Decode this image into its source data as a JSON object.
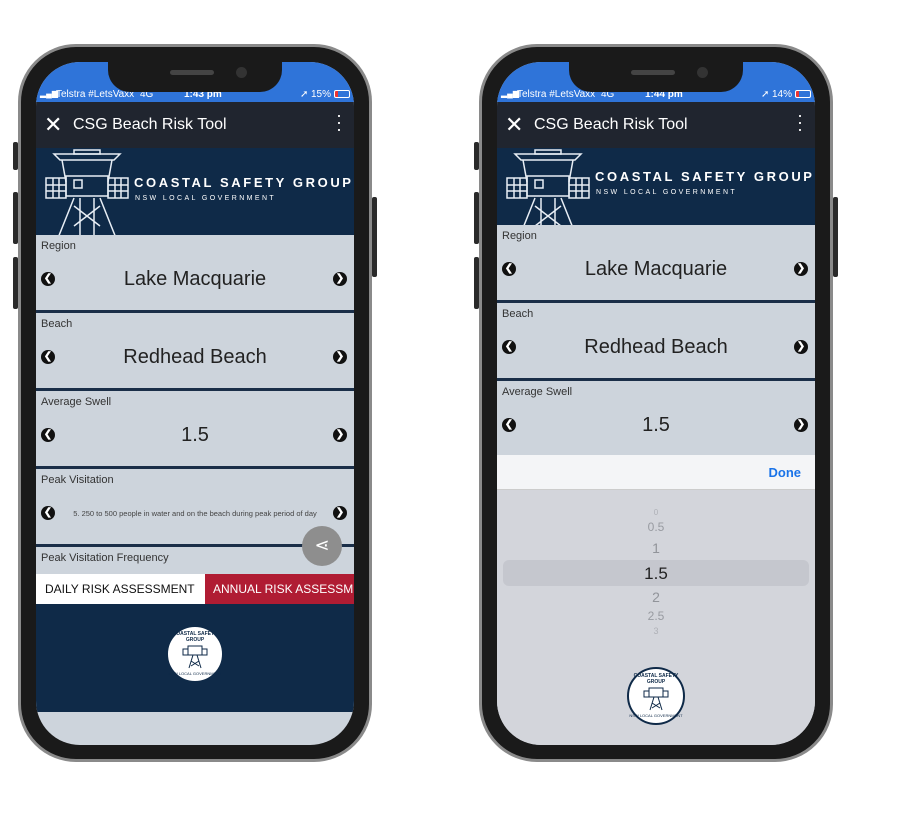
{
  "phones": [
    {
      "status": {
        "carrier": "Telstra #LetsVaxx",
        "network": "4G",
        "time": "1:43 pm",
        "battery": "15%"
      },
      "app_title": "CSG Beach Risk Tool",
      "banner": {
        "title": "COASTAL SAFETY GROUP",
        "subtitle": "NSW LOCAL GOVERNMENT"
      },
      "fields": [
        {
          "label": "Region",
          "value": "Lake Macquarie"
        },
        {
          "label": "Beach",
          "value": "Redhead Beach"
        },
        {
          "label": "Average Swell",
          "value": "1.5"
        },
        {
          "label": "Peak Visitation",
          "value": "5. 250 to 500 people in water and on the beach during peak period of day"
        },
        {
          "label": "Peak Visitation Frequency"
        }
      ],
      "tabs": [
        {
          "label": "DAILY RISK ASSESSMENT",
          "active": true
        },
        {
          "label": "ANNUAL RISK ASSESSM",
          "active": false
        }
      ],
      "seal": {
        "top": "COASTAL SAFETY GROUP",
        "bottom": "NSW LOCAL GOVERNMENT"
      }
    },
    {
      "status": {
        "carrier": "Telstra #LetsVaxx",
        "network": "4G",
        "time": "1:44 pm",
        "battery": "14%"
      },
      "app_title": "CSG Beach Risk Tool",
      "banner": {
        "title": "COASTAL SAFETY GROUP",
        "subtitle": "NSW LOCAL GOVERNMENT"
      },
      "fields": [
        {
          "label": "Region",
          "value": "Lake Macquarie"
        },
        {
          "label": "Beach",
          "value": "Redhead Beach"
        },
        {
          "label": "Average Swell",
          "value": "1.5"
        }
      ],
      "picker": {
        "done_label": "Done",
        "options": [
          "0",
          "0.5",
          "1",
          "1.5",
          "2",
          "2.5",
          "3"
        ],
        "selected": "1.5"
      },
      "seal": {
        "top": "COASTAL SAFETY GROUP",
        "bottom": "NSW LOCAL GOVERNMENT"
      }
    }
  ],
  "colors": {
    "status_bar": "#2f74d9",
    "app_bar": "#20252f",
    "navy": "#0f2a48",
    "field_bg": "#cdd4dc",
    "annual_tab": "#b01c33",
    "done": "#1a73e8"
  },
  "icons": [
    "close-icon",
    "more-vertical-icon",
    "chevron-left-icon",
    "chevron-right-icon",
    "share-icon",
    "signal-icon",
    "location-icon",
    "battery-icon"
  ]
}
